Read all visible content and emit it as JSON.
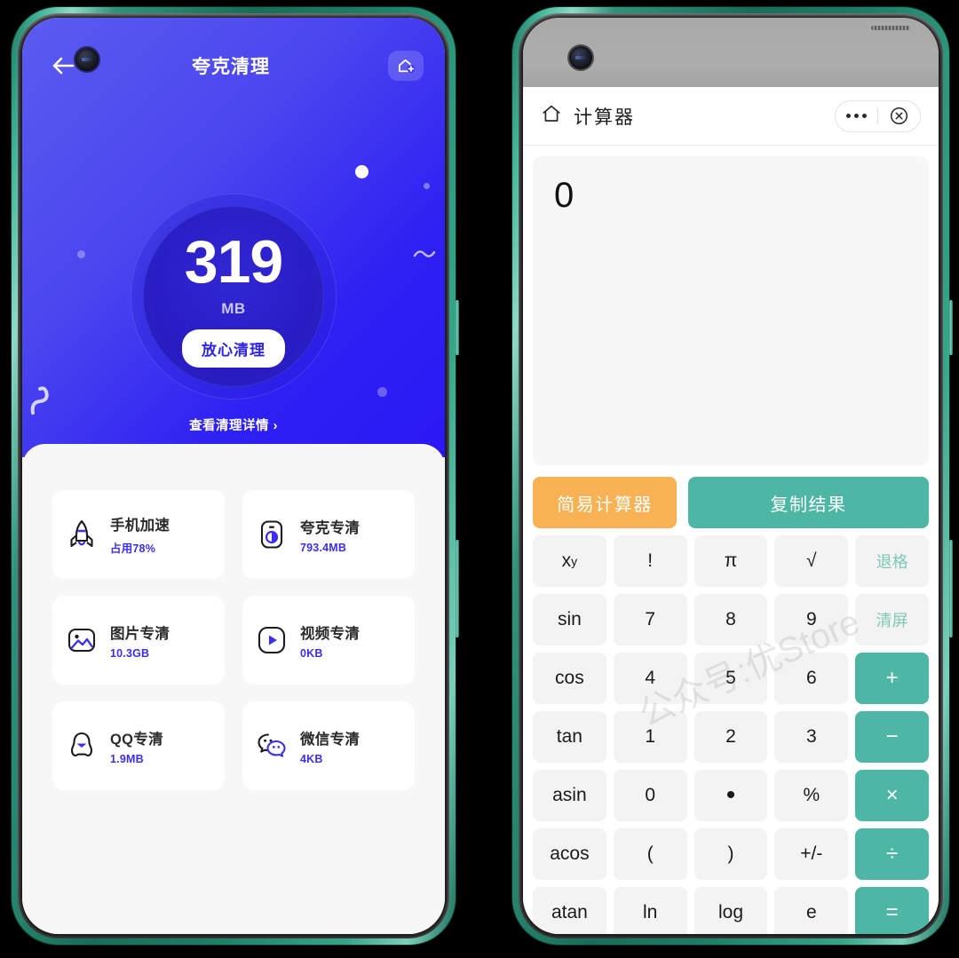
{
  "left_phone": {
    "header": {
      "back_icon": "back-arrow-icon",
      "title": "夸克清理",
      "add_home_icon": "add-to-home-icon"
    },
    "gauge": {
      "value": "319",
      "unit": "MB",
      "action_label": "放心清理"
    },
    "detail_link": "查看清理详情 ›",
    "cards": [
      {
        "icon": "rocket-icon",
        "name": "手机加速",
        "sub": "占用78%"
      },
      {
        "icon": "quark-icon",
        "name": "夸克专清",
        "sub": "793.4MB"
      },
      {
        "icon": "image-icon",
        "name": "图片专清",
        "sub": "10.3GB"
      },
      {
        "icon": "video-icon",
        "name": "视频专清",
        "sub": "0KB"
      },
      {
        "icon": "qq-icon",
        "name": "QQ专清",
        "sub": "1.9MB"
      },
      {
        "icon": "wechat-icon",
        "name": "微信专清",
        "sub": "4KB"
      }
    ],
    "colors": {
      "hero_gradient_start": "#5b5bf0",
      "hero_gradient_end": "#2b17f5",
      "accent": "#3b2ef5",
      "sheet_bg": "#f7f7f8"
    }
  },
  "right_phone": {
    "appbar": {
      "home_icon": "home-icon",
      "title": "计算器",
      "more_icon": "more-dots-icon",
      "close_icon": "close-circle-icon"
    },
    "display_value": "0",
    "modes": [
      {
        "label": "简易计算器",
        "color": "#f8b254"
      },
      {
        "label": "复制结果",
        "color": "#4db6a4"
      }
    ],
    "keys": [
      [
        {
          "label": "x",
          "sup": "y",
          "style": "normal"
        },
        {
          "label": "!",
          "style": "normal"
        },
        {
          "label": "π",
          "style": "normal"
        },
        {
          "label": "√",
          "style": "normal"
        },
        {
          "label": "退格",
          "style": "muted"
        }
      ],
      [
        {
          "label": "sin",
          "style": "normal"
        },
        {
          "label": "7",
          "style": "normal"
        },
        {
          "label": "8",
          "style": "normal"
        },
        {
          "label": "9",
          "style": "normal"
        },
        {
          "label": "清屏",
          "style": "muted"
        }
      ],
      [
        {
          "label": "cos",
          "style": "normal"
        },
        {
          "label": "4",
          "style": "normal"
        },
        {
          "label": "5",
          "style": "normal"
        },
        {
          "label": "6",
          "style": "normal"
        },
        {
          "label": "+",
          "style": "op"
        }
      ],
      [
        {
          "label": "tan",
          "style": "normal"
        },
        {
          "label": "1",
          "style": "normal"
        },
        {
          "label": "2",
          "style": "normal"
        },
        {
          "label": "3",
          "style": "normal"
        },
        {
          "label": "−",
          "style": "op"
        }
      ],
      [
        {
          "label": "asin",
          "style": "normal"
        },
        {
          "label": "0",
          "style": "normal"
        },
        {
          "label": "•",
          "style": "dot"
        },
        {
          "label": "%",
          "style": "normal"
        },
        {
          "label": "×",
          "style": "op"
        }
      ],
      [
        {
          "label": "acos",
          "style": "normal"
        },
        {
          "label": "(",
          "style": "normal"
        },
        {
          "label": ")",
          "style": "normal"
        },
        {
          "label": "+/-",
          "style": "normal"
        },
        {
          "label": "÷",
          "style": "op"
        }
      ],
      [
        {
          "label": "atan",
          "style": "normal"
        },
        {
          "label": "ln",
          "style": "normal"
        },
        {
          "label": "log",
          "style": "normal"
        },
        {
          "label": "e",
          "style": "normal"
        },
        {
          "label": "=",
          "style": "op"
        }
      ]
    ],
    "watermark": "公众号:优Store",
    "colors": {
      "teal": "#4db6a4",
      "orange": "#f8b254",
      "key_bg": "#f3f3f3"
    }
  }
}
